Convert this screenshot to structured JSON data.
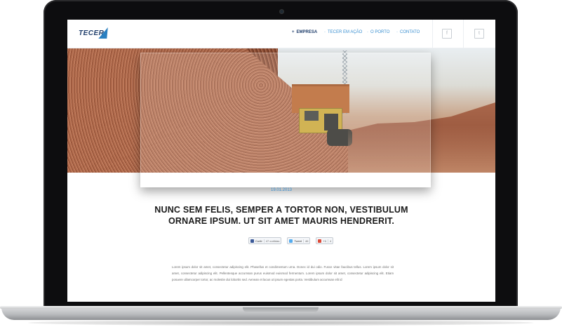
{
  "site": {
    "logo_text": "TECER"
  },
  "nav": {
    "items": [
      {
        "label": "EMPRESA",
        "active": true
      },
      {
        "label": "TECER EM AÇÃO",
        "active": false
      },
      {
        "label": "O PORTO",
        "active": false
      },
      {
        "label": "CONTATO",
        "active": false
      }
    ],
    "bullet": "+",
    "bullet_inactive": "·"
  },
  "social": {
    "facebook": "f",
    "twitter": "t"
  },
  "article": {
    "date": "19.01.2013",
    "title": "NUNC SEM FELIS, SEMPER A TORTOR NON, VESTIBULUM ORNARE IPSUM. UT SIT AMET MAURIS HENDRERIT.",
    "shares": [
      {
        "label": "Curtir",
        "count": "47 curtidas",
        "icon": "facebook-icon",
        "color": "#3b5998"
      },
      {
        "label": "Tweet",
        "count": "46",
        "icon": "twitter-icon",
        "color": "#55acee"
      },
      {
        "label": "+1",
        "count": "4",
        "icon": "google-plus-icon",
        "color": "#dd4b39"
      }
    ],
    "body": "Lorem ipsum dolor sit amet, consectetur adipiscing elit. Phasellus et condimentum urna. Donec id dui odio. Fusce vitae faucibus tellus. Lorem ipsum dolor sit amet, consectetur adipiscing elit. Pellentesque accumsan purus euismod euismod fermentum. Lorem ipsum dolor sit amet, consectetur adipiscing elit. Etiam posuere ullamcorper tortor, ac molestie dui lobortis sed. Aenean et lacus ut ipsum egestas porta. Vestibulum accumsan elit id"
  },
  "colors": {
    "accent": "#3a8fd0",
    "brand": "#1e3d6b"
  }
}
